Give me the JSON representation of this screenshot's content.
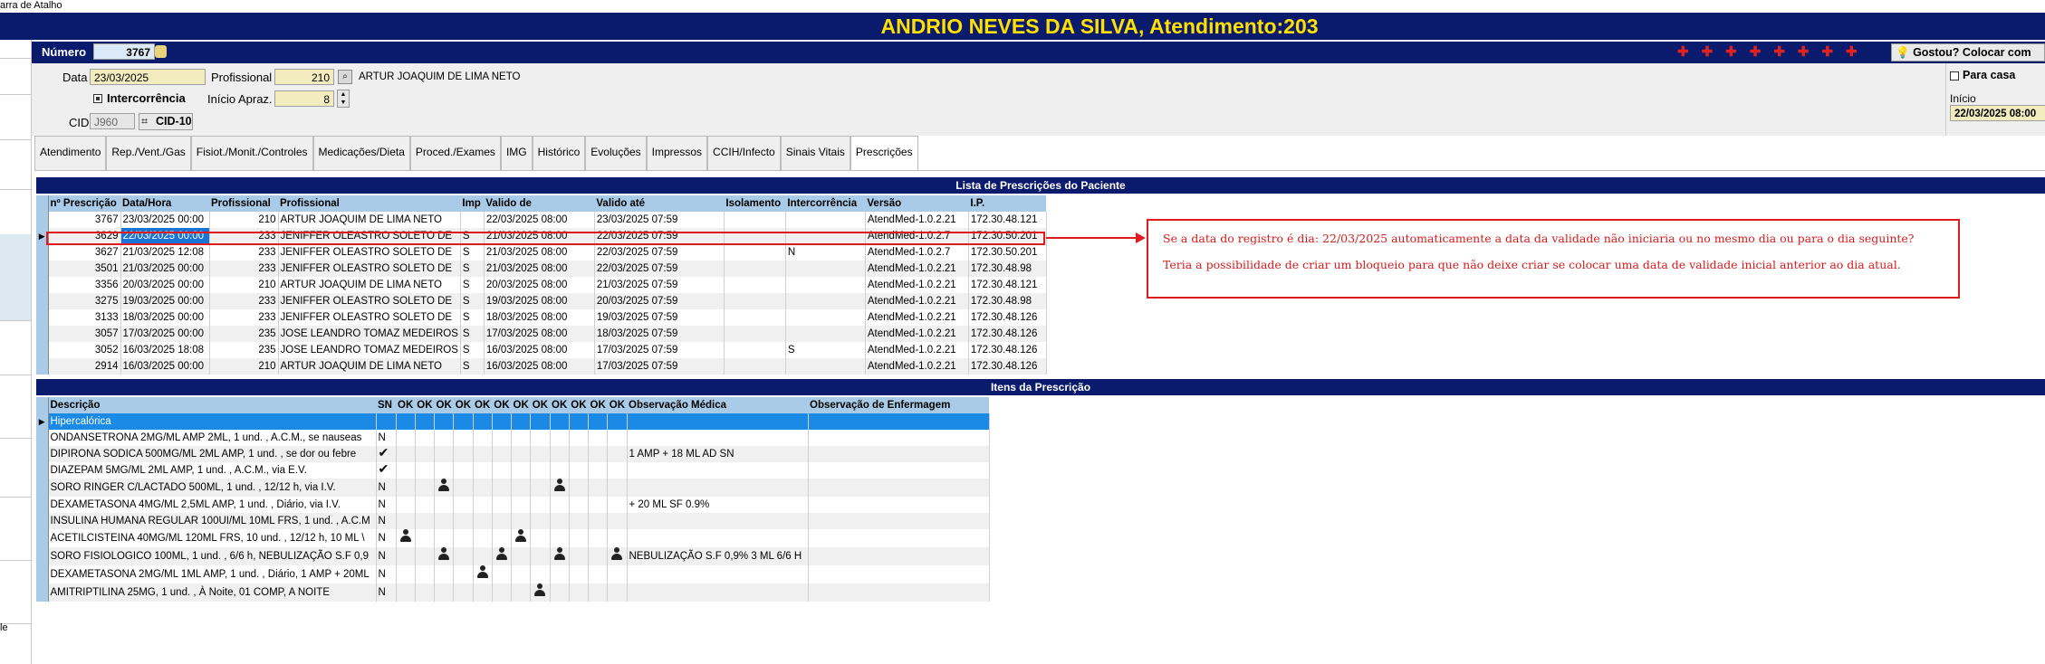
{
  "shortcut_bar": {
    "label": "arra de Atalho"
  },
  "left_column": {
    "fragment": "le"
  },
  "title": "ANDRIO NEVES DA SILVA, Atendimento:203",
  "header": {
    "numero_label": "Número",
    "numero_value": "3767",
    "data_label": "Data",
    "data_value": "23/03/2025",
    "profissional_label": "Profissional",
    "profissional_code": "210",
    "profissional_name": "ARTUR JOAQUIM DE LIMA NETO",
    "intercorrencia_label": "Intercorrência",
    "inicio_aprazamento_label": "Início Apraz.",
    "inicio_aprazamento_value": "8",
    "cid_label": "CID",
    "cid_value": "J960",
    "cid10_button": "CID-10",
    "gostou_button": "Gostou? Colocar com",
    "para_casa_label": "Para casa",
    "inicio_label": "Início",
    "inicio_value": "22/03/2025 08:00"
  },
  "tabs": [
    "Atendimento",
    "Rep./Vent./Gas",
    "Fisiot./Monit./Controles",
    "Medicações/Dieta",
    "Proced./Exames",
    "IMG",
    "Histórico",
    "Evoluções",
    "Impressos",
    "CCIH/Infecto",
    "Sinais Vitais",
    "Prescrições"
  ],
  "active_tab": "Prescrições",
  "prescriptions": {
    "title": "Lista de Prescrições do Paciente",
    "columns": [
      "nº Prescrição",
      "Data/Hora",
      "Profissional",
      "Profissional",
      "Imp",
      "Valido de",
      "Valido até",
      "Isolamento",
      "Intercorrência",
      "Versão",
      "I.P."
    ],
    "rows": [
      [
        "3767",
        "23/03/2025 00:00",
        "210",
        "ARTUR JOAQUIM DE LIMA NETO",
        "",
        "22/03/2025 08:00",
        "23/03/2025 07:59",
        "",
        "",
        "AtendMed-1.0.2.21",
        "172.30.48.121"
      ],
      [
        "3629",
        "22/03/2025 00:00",
        "233",
        "JENIFFER OLEASTRO SOLETO DE",
        "S",
        "21/03/2025 08:00",
        "22/03/2025 07:59",
        "",
        "",
        "AtendMed-1.0.2.7",
        "172.30.50.201"
      ],
      [
        "3627",
        "21/03/2025 12:08",
        "233",
        "JENIFFER OLEASTRO SOLETO DE",
        "S",
        "21/03/2025 08:00",
        "22/03/2025 07:59",
        "",
        "N",
        "AtendMed-1.0.2.7",
        "172.30.50.201"
      ],
      [
        "3501",
        "21/03/2025 00:00",
        "233",
        "JENIFFER OLEASTRO SOLETO DE",
        "S",
        "21/03/2025 08:00",
        "22/03/2025 07:59",
        "",
        "",
        "AtendMed-1.0.2.21",
        "172.30.48.98"
      ],
      [
        "3356",
        "20/03/2025 00:00",
        "210",
        "ARTUR JOAQUIM DE LIMA NETO",
        "S",
        "20/03/2025 08:00",
        "21/03/2025 07:59",
        "",
        "",
        "AtendMed-1.0.2.21",
        "172.30.48.121"
      ],
      [
        "3275",
        "19/03/2025 00:00",
        "233",
        "JENIFFER OLEASTRO SOLETO DE",
        "S",
        "19/03/2025 08:00",
        "20/03/2025 07:59",
        "",
        "",
        "AtendMed-1.0.2.21",
        "172.30.48.98"
      ],
      [
        "3133",
        "18/03/2025 00:00",
        "233",
        "JENIFFER OLEASTRO SOLETO DE",
        "S",
        "18/03/2025 08:00",
        "19/03/2025 07:59",
        "",
        "",
        "AtendMed-1.0.2.21",
        "172.30.48.126"
      ],
      [
        "3057",
        "17/03/2025 00:00",
        "235",
        "JOSE LEANDRO TOMAZ MEDEIROS",
        "S",
        "17/03/2025 08:00",
        "18/03/2025 07:59",
        "",
        "",
        "AtendMed-1.0.2.21",
        "172.30.48.126"
      ],
      [
        "3052",
        "16/03/2025 18:08",
        "235",
        "JOSE LEANDRO TOMAZ MEDEIROS",
        "S",
        "16/03/2025 08:00",
        "17/03/2025 07:59",
        "",
        "S",
        "AtendMed-1.0.2.21",
        "172.30.48.126"
      ],
      [
        "2914",
        "16/03/2025 00:00",
        "210",
        "ARTUR JOAQUIM DE LIMA NETO",
        "S",
        "16/03/2025 08:00",
        "17/03/2025 07:59",
        "",
        "",
        "AtendMed-1.0.2.21",
        "172.30.48.126"
      ]
    ]
  },
  "items": {
    "title": "Itens da Prescrição",
    "columns": [
      "Descrição",
      "SN",
      "OK",
      "OK",
      "OK",
      "OK",
      "OK",
      "OK",
      "OK",
      "OK",
      "OK",
      "OK",
      "OK",
      "OK",
      "Observação Médica",
      "Observação de Enfermagem"
    ],
    "rows": [
      {
        "desc": "Hipercalórica",
        "sn": "",
        "ok": [
          "",
          "",
          "",
          "",
          "",
          "",
          "",
          "",
          "",
          "",
          "",
          ""
        ],
        "obs_med": "",
        "obs_enf": ""
      },
      {
        "desc": "ONDANSETRONA 2MG/ML AMP 2ML, 1 und. , A.C.M., se nauseas",
        "sn": "N",
        "ok": [
          "",
          "",
          "",
          "",
          "",
          "",
          "",
          "",
          "",
          "",
          "",
          ""
        ],
        "obs_med": "",
        "obs_enf": ""
      },
      {
        "desc": "DIPIRONA SODICA 500MG/ML 2ML AMP, 1 und. , se dor ou febre",
        "sn": "check",
        "ok": [
          "",
          "",
          "",
          "",
          "",
          "",
          "",
          "",
          "",
          "",
          "",
          ""
        ],
        "obs_med": "1 AMP + 18 ML AD SN",
        "obs_enf": ""
      },
      {
        "desc": "DIAZEPAM 5MG/ML 2ML AMP, 1 und. , A.C.M., via E.V.",
        "sn": "check",
        "ok": [
          "",
          "",
          "",
          "",
          "",
          "",
          "",
          "",
          "",
          "",
          "",
          ""
        ],
        "obs_med": "",
        "obs_enf": ""
      },
      {
        "desc": "SORO RINGER C/LACTADO 500ML, 1 und. , 12/12 h, via I.V.",
        "sn": "N",
        "ok": [
          "",
          "",
          "person",
          "",
          "",
          "",
          "",
          "",
          "person",
          "",
          "",
          ""
        ],
        "obs_med": "",
        "obs_enf": ""
      },
      {
        "desc": "DEXAMETASONA 4MG/ML 2,5ML AMP, 1 und. , Diário, via I.V.",
        "sn": "N",
        "ok": [
          "",
          "",
          "",
          "",
          "",
          "",
          "",
          "",
          "",
          "",
          "",
          ""
        ],
        "obs_med": "+ 20 ML SF 0.9%",
        "obs_enf": ""
      },
      {
        "desc": "INSULINA HUMANA REGULAR 100UI/ML 10ML FRS, 1 und. , A.C.M",
        "sn": "N",
        "ok": [
          "",
          "",
          "",
          "",
          "",
          "",
          "",
          "",
          "",
          "",
          "",
          ""
        ],
        "obs_med": "",
        "obs_enf": ""
      },
      {
        "desc": "ACETILCISTEINA 40MG/ML 120ML FRS, 10 und. , 12/12 h, 10 ML \\",
        "sn": "N",
        "ok": [
          "person",
          "",
          "",
          "",
          "",
          "",
          "person",
          "",
          "",
          "",
          "",
          ""
        ],
        "obs_med": "",
        "obs_enf": ""
      },
      {
        "desc": "SORO FISIOLOGICO 100ML, 1 und. , 6/6 h, NEBULIZAÇÃO S.F 0,9",
        "sn": "N",
        "ok": [
          "",
          "",
          "person",
          "",
          "",
          "person",
          "",
          "",
          "person",
          "",
          "",
          "person"
        ],
        "obs_med": "NEBULIZAÇÃO S.F 0,9% 3 ML 6/6 H",
        "obs_enf": ""
      },
      {
        "desc": "DEXAMETASONA 2MG/ML 1ML AMP, 1 und. , Diário, 1 AMP + 20ML",
        "sn": "N",
        "ok": [
          "",
          "",
          "",
          "",
          "person",
          "",
          "",
          "",
          "",
          "",
          "",
          ""
        ],
        "obs_med": "",
        "obs_enf": ""
      },
      {
        "desc": "AMITRIPTILINA 25MG, 1 und. , À Noite, 01 COMP, A NOITE",
        "sn": "N",
        "ok": [
          "",
          "",
          "",
          "",
          "",
          "",
          "",
          "person",
          "",
          "",
          "",
          ""
        ],
        "obs_med": "",
        "obs_enf": ""
      }
    ]
  },
  "annotation": {
    "line1": "Se a data do registro é dia: 22/03/2025 automaticamente a data da validade não iniciaria ou no mesmo dia ou para o dia seguinte?",
    "line2": "Teria a possibilidade de criar um bloqueio para que não deixe criar se colocar uma data de validade inicial anterior ao dia atual."
  },
  "colors": {
    "title_bg": "#0a1a6d",
    "title_fg": "#ffe000",
    "annotation": "#e01b1b",
    "header_row": "#a9cbe7",
    "selection": "#1a74d6"
  }
}
